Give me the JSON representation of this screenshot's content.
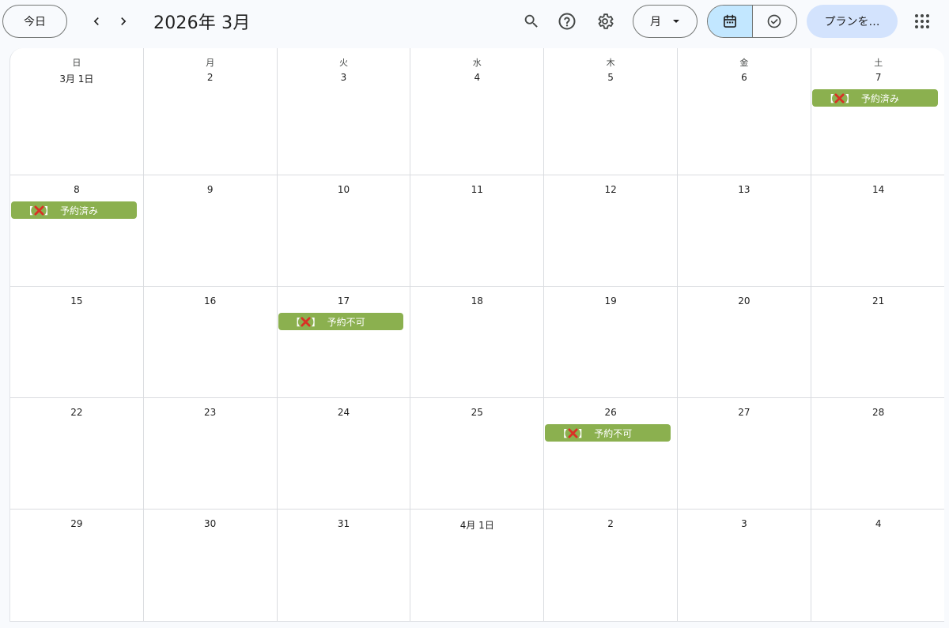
{
  "toolbar": {
    "today_label": "今日",
    "title": "2026年 3月",
    "view_label": "月",
    "plan_label": "プランを…",
    "icons": {
      "prev": "chevron-left-icon",
      "next": "chevron-right-icon",
      "search": "search-icon",
      "help": "help-icon",
      "settings": "gear-icon",
      "dropdown": "caret-down-icon",
      "calendar": "calendar-icon",
      "tasks": "check-circle-icon",
      "apps": "apps-grid-icon"
    }
  },
  "calendar": {
    "weekdays": [
      "日",
      "月",
      "火",
      "水",
      "木",
      "金",
      "土"
    ],
    "weeks": [
      [
        "3月 1日",
        "2",
        "3",
        "4",
        "5",
        "6",
        "7"
      ],
      [
        "8",
        "9",
        "10",
        "11",
        "12",
        "13",
        "14"
      ],
      [
        "15",
        "16",
        "17",
        "18",
        "19",
        "20",
        "21"
      ],
      [
        "22",
        "23",
        "24",
        "25",
        "26",
        "27",
        "28"
      ],
      [
        "29",
        "30",
        "31",
        "4月 1日",
        "2",
        "3",
        "4"
      ]
    ],
    "events": [
      {
        "week": 0,
        "day": 6,
        "bracket_open": "【",
        "bracket_close": "】",
        "label": "予約済み"
      },
      {
        "week": 1,
        "day": 0,
        "bracket_open": "【",
        "bracket_close": "】",
        "label": "予約済み"
      },
      {
        "week": 2,
        "day": 2,
        "bracket_open": "【",
        "bracket_close": "】",
        "label": "予約不可"
      },
      {
        "week": 3,
        "day": 4,
        "bracket_open": "【",
        "bracket_close": "】",
        "label": "予約不可"
      }
    ],
    "colors": {
      "event": "#8bb04f",
      "cross": "#d93025",
      "active_segment": "#c2e7ff",
      "plan_button": "#d3e3fd"
    }
  }
}
